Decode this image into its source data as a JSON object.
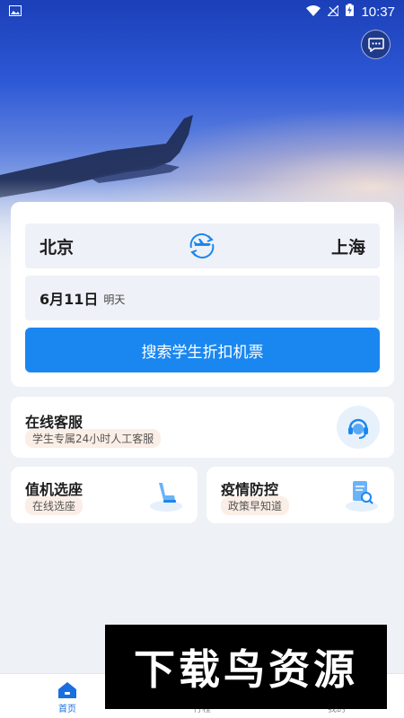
{
  "status_bar": {
    "time": "10:37"
  },
  "route": {
    "from": "北京",
    "to": "上海"
  },
  "date": {
    "value": "6月11日",
    "relative": "明天"
  },
  "search_button": "搜索学生折扣机票",
  "customer_service": {
    "title": "在线客服",
    "tag": "学生专属24小时人工客服"
  },
  "seat_selection": {
    "title": "值机选座",
    "tag": "在线选座"
  },
  "epidemic": {
    "title": "疫情防控",
    "tag": "政策早知道"
  },
  "nav": [
    {
      "label": "首页",
      "icon": "home-icon",
      "active": true
    },
    {
      "label": "行程",
      "icon": "itinerary-icon",
      "active": false
    },
    {
      "label": "我的",
      "icon": "profile-icon",
      "active": false
    }
  ],
  "watermark": "下载鸟资源",
  "colors": {
    "primary": "#1a87f0",
    "tag_bg": "#fbeee6",
    "page_bg": "#eef1f5"
  }
}
